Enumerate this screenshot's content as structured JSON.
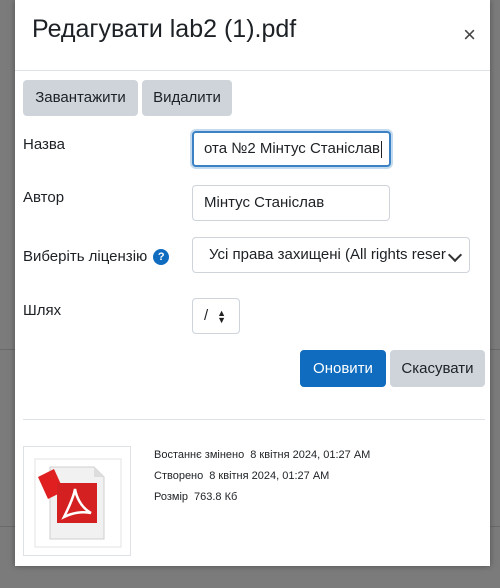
{
  "dialog": {
    "title": "Редагувати lab2 (1).pdf",
    "close_symbol": "×"
  },
  "toolbar": {
    "download_label": "Завантажити",
    "delete_label": "Видалити"
  },
  "form": {
    "name_label": "Назва",
    "name_value": "ота №2 Мінтус Станіслав",
    "author_label": "Автор",
    "author_value": "Мінтус Станіслав",
    "license_label": "Виберіть ліцензію",
    "license_help_icon": "question-circle-icon",
    "license_value": "Усі права захищені (All rights reser",
    "path_label": "Шлях",
    "path_value": "/"
  },
  "actions": {
    "update_label": "Оновити",
    "cancel_label": "Скасувати"
  },
  "file_info": {
    "icon": "pdf-file-icon",
    "modified_label": "Востаннє змінено",
    "modified_value": "8 квітня 2024, 01:27 AM",
    "created_label": "Створено",
    "created_value": "8 квітня 2024, 01:27 AM",
    "size_label": "Розмір",
    "size_value": "763.8 Кб"
  },
  "colors": {
    "primary": "#0f6cbf",
    "secondary": "#ced4da",
    "focus": "#3b82c4",
    "pdf_red": "#e02020"
  }
}
